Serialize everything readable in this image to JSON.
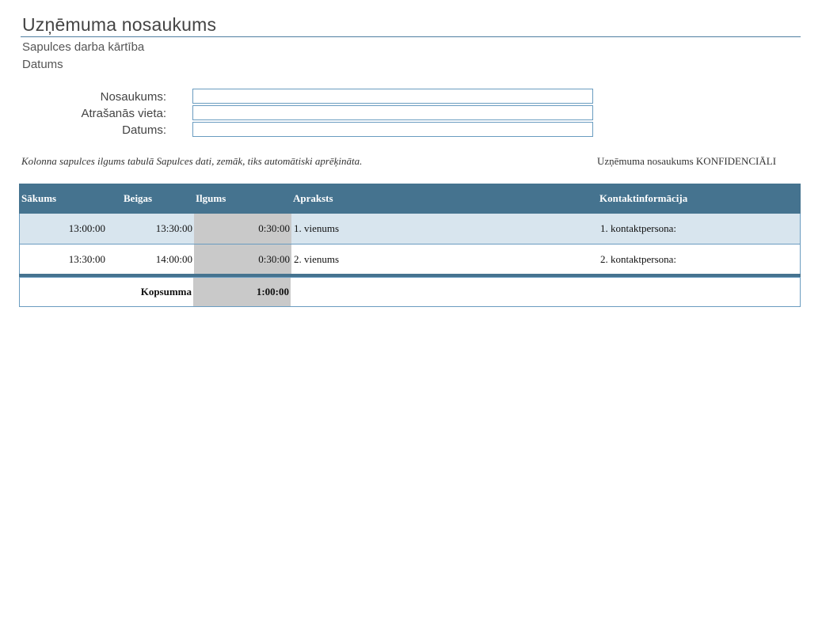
{
  "header": {
    "title": "Uzņēmuma nosaukums",
    "subtitle": "Sapulces darba kārtība",
    "date_label": "Datums"
  },
  "form": {
    "fields": [
      {
        "label": "Nosaukums:",
        "value": ""
      },
      {
        "label": "Atrašanās vieta:",
        "value": ""
      },
      {
        "label": "Datums:",
        "value": ""
      }
    ]
  },
  "note": "Kolonna sapulces ilgums tabulā Sapulces dati, zemāk, tiks automātiski aprēķināta.",
  "confidential": "Uzņēmuma nosaukums KONFIDENCIĀLI",
  "table": {
    "headers": [
      "Sākums",
      "Beigas",
      "Ilgums",
      "Apraksts",
      "Kontaktinformācija"
    ],
    "rows": [
      {
        "start": "13:00:00",
        "end": "13:30:00",
        "duration": "0:30:00",
        "desc": "1. vienums",
        "contact": "1. kontaktpersona:"
      },
      {
        "start": "13:30:00",
        "end": "14:00:00",
        "duration": "0:30:00",
        "desc": "2. vienums",
        "contact": "2. kontaktpersona:"
      }
    ],
    "total_label": "Kopsumma",
    "total_value": "1:00:00"
  },
  "colors": {
    "header_bg": "#45738f",
    "alt_row_bg": "#d8e5ee",
    "duration_bg": "#c9c9c9",
    "accent": "#4f7fa0"
  }
}
